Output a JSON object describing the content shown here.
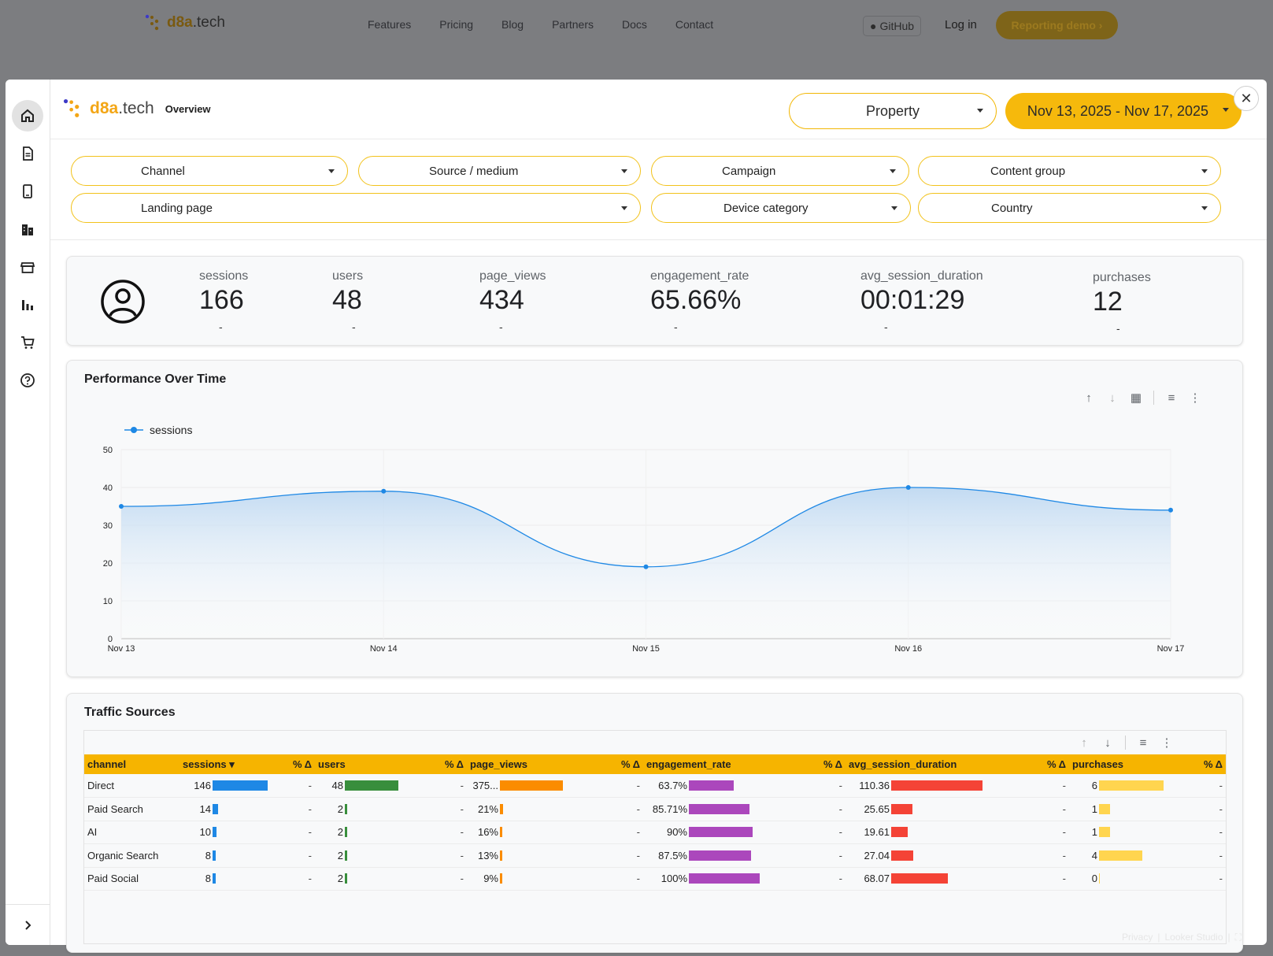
{
  "site": {
    "logo_d8a": "d8a",
    "logo_tech": ".tech",
    "nav": [
      "Features",
      "Pricing",
      "Blog",
      "Partners",
      "Docs",
      "Contact"
    ],
    "github": "GitHub",
    "login": "Log in",
    "demo": "Reporting demo ›"
  },
  "header": {
    "brand_d8a": "d8a",
    "brand_tech": ".tech",
    "page": "Overview",
    "property": "Property",
    "date_range": "Nov 13, 2025 - Nov 17, 2025"
  },
  "filters": {
    "channel": "Channel",
    "source_medium": "Source / medium",
    "campaign": "Campaign",
    "content_group": "Content group",
    "landing_page": "Landing page",
    "device_category": "Device category",
    "country": "Country"
  },
  "kpis": [
    {
      "label": "sessions",
      "value": "166",
      "delta": "-"
    },
    {
      "label": "users",
      "value": "48",
      "delta": "-"
    },
    {
      "label": "page_views",
      "value": "434",
      "delta": "-"
    },
    {
      "label": "engagement_rate",
      "value": "65.66%",
      "delta": "-"
    },
    {
      "label": "avg_session_duration",
      "value": "00:01:29",
      "delta": "-"
    },
    {
      "label": "purchases",
      "value": "12",
      "delta": "-"
    }
  ],
  "performance": {
    "title": "Performance Over Time"
  },
  "chart_data": {
    "type": "line",
    "title": "Performance Over Time",
    "categories": [
      "Nov 13",
      "Nov 14",
      "Nov 15",
      "Nov 16",
      "Nov 17"
    ],
    "series": [
      {
        "name": "sessions",
        "values": [
          35,
          39,
          19,
          40,
          34
        ],
        "color": "#1e88e5"
      }
    ],
    "ylim": [
      0,
      50
    ],
    "yticks": [
      0,
      10,
      20,
      30,
      40,
      50
    ],
    "area": true,
    "grid": true,
    "legend": "top-left"
  },
  "traffic": {
    "title": "Traffic Sources",
    "columns": [
      "channel",
      "sessions",
      "% Δ",
      "users",
      "% Δ",
      "page_views",
      "% Δ",
      "engagement_rate",
      "% Δ",
      "avg_session_duration",
      "% Δ",
      "purchases",
      "% Δ"
    ],
    "rows": [
      {
        "channel": "Direct",
        "sessions": "146",
        "users": "48",
        "page_views": "375...",
        "engagement_rate": "63.7%",
        "avg_session_duration": "110.36",
        "purchases": "6",
        "d": "-"
      },
      {
        "channel": "Paid Search",
        "sessions": "14",
        "users": "2",
        "page_views": "21%",
        "engagement_rate": "85.71%",
        "avg_session_duration": "25.65",
        "purchases": "1",
        "d": "-"
      },
      {
        "channel": "AI",
        "sessions": "10",
        "users": "2",
        "page_views": "16%",
        "engagement_rate": "90%",
        "avg_session_duration": "19.61",
        "purchases": "1",
        "d": "-"
      },
      {
        "channel": "Organic Search",
        "sessions": "8",
        "users": "2",
        "page_views": "13%",
        "engagement_rate": "87.5%",
        "avg_session_duration": "27.04",
        "purchases": "4",
        "d": "-"
      },
      {
        "channel": "Paid Social",
        "sessions": "8",
        "users": "2",
        "page_views": "9%",
        "engagement_rate": "100%",
        "avg_session_duration": "68.07",
        "purchases": "0",
        "d": "-"
      }
    ],
    "bar_fraction": {
      "sessions": [
        1.0,
        0.096,
        0.068,
        0.055,
        0.055
      ],
      "users": [
        1.0,
        0.042,
        0.042,
        0.042,
        0.042
      ],
      "page_views": [
        1.0,
        0.056,
        0.043,
        0.035,
        0.024
      ],
      "engagement_rate": [
        0.637,
        0.857,
        0.9,
        0.875,
        1.0
      ],
      "avg_session_duration": [
        1.0,
        0.232,
        0.178,
        0.245,
        0.617
      ],
      "purchases": [
        1.0,
        0.167,
        0.167,
        0.667,
        0.0
      ]
    },
    "bar_colors": {
      "sessions": "#1e88e5",
      "users": "#388e3c",
      "page_views": "#fb8c00",
      "engagement_rate": "#ab47bc",
      "avg_session_duration": "#f44336",
      "purchases": "#ffd54f"
    }
  },
  "footer": {
    "privacy": "Privacy",
    "looker": "Looker Studio"
  }
}
